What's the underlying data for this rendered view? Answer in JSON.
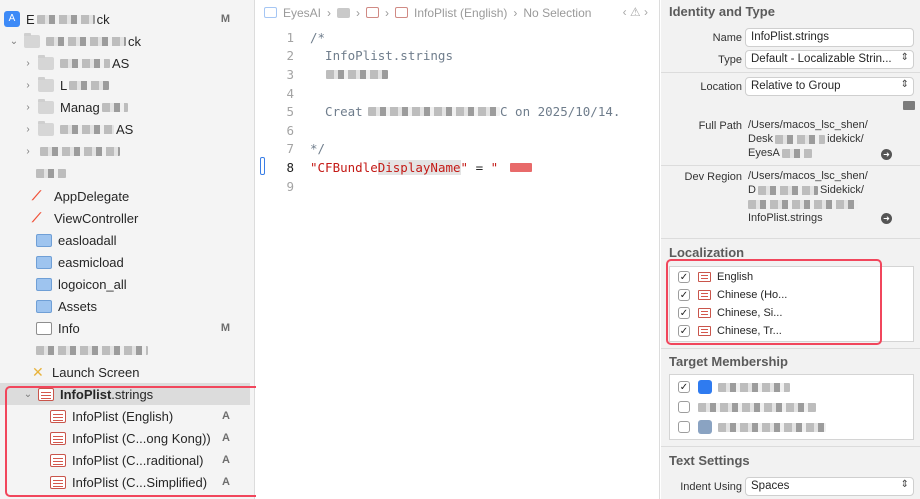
{
  "navigator": {
    "project_name": "E",
    "project_suffix": "ck",
    "project_badge": "M",
    "group_name_suffix": "ck",
    "folders": [
      {
        "label": "AS"
      },
      {
        "label": "L"
      },
      {
        "label": "Manag"
      },
      {
        "label": "AS"
      },
      {
        "label": ""
      }
    ],
    "files": [
      {
        "label": "AppDelegate",
        "badge": ""
      },
      {
        "label": "ViewController",
        "badge": ""
      },
      {
        "label": "easloadall",
        "badge": ""
      },
      {
        "label": "easmicload",
        "badge": ""
      },
      {
        "label": "logoicon_all",
        "badge": ""
      },
      {
        "label": "Assets",
        "badge": ""
      },
      {
        "label": "Info",
        "badge": "M"
      },
      {
        "label": "",
        "badge": ""
      },
      {
        "label": "Launch Screen",
        "badge": ""
      }
    ],
    "strings_group": {
      "prefix": "InfoPlist",
      "suffix": ".strings"
    },
    "localized_files": [
      {
        "label": "InfoPlist (English)",
        "badge": "A"
      },
      {
        "label": "InfoPlist (C...ong Kong))",
        "badge": "A"
      },
      {
        "label": "InfoPlist (C...raditional)",
        "badge": "A"
      },
      {
        "label": "InfoPlist (C...Simplified)",
        "badge": "A"
      }
    ]
  },
  "editor": {
    "jumpbar": {
      "project": "EyesAI",
      "file": "InfoPlist (English)",
      "selection": "No Selection",
      "nav": "‹ ⚠ ›"
    },
    "lines": [
      {
        "n": "1",
        "text": "/*"
      },
      {
        "n": "2",
        "text": "  InfoPlist.strings"
      },
      {
        "n": "3",
        "text": ""
      },
      {
        "n": "4",
        "text": ""
      },
      {
        "n": "5",
        "text_prefix": "  Creat",
        "text_suffix": "C on 2025/10/14."
      },
      {
        "n": "6",
        "text": ""
      },
      {
        "n": "7",
        "text": "*/"
      },
      {
        "n": "8",
        "key_open": "\"CFBundle",
        "key_hl": "DisplayName",
        "key_close": "\"",
        "eq": " = ",
        "val_open": "\""
      },
      {
        "n": "9",
        "text": ""
      }
    ]
  },
  "inspector": {
    "identity_title": "Identity and Type",
    "name_label": "Name",
    "name_value": "InfoPlist.strings",
    "type_label": "Type",
    "type_value": "Default - Localizable Strin...",
    "location_label": "Location",
    "location_value": "Relative to Group",
    "fullpath_label": "Full Path",
    "fullpath_lines": [
      "/Users/macos_lsc_shen/",
      "Desk",
      "EyesA"
    ],
    "fullpath_line2_suffix": "idekick/",
    "devregion_label": "Dev Region",
    "devregion_lines": [
      "/Users/macos_lsc_shen/",
      "D",
      "InfoPlist.strings"
    ],
    "devregion_line2_suffix": "Sidekick/",
    "localization_title": "Localization",
    "localizations": [
      {
        "label": "English",
        "checked": "✓"
      },
      {
        "label": "Chinese (Ho...",
        "checked": "✓"
      },
      {
        "label": "Chinese, Si...",
        "checked": "✓"
      },
      {
        "label": "Chinese, Tr...",
        "checked": "✓"
      }
    ],
    "target_title": "Target Membership",
    "targets": [
      {
        "checked": "✓"
      },
      {
        "checked": ""
      },
      {
        "checked": ""
      }
    ],
    "text_settings_title": "Text Settings",
    "indent_label": "Indent Using",
    "indent_value": "Spaces"
  }
}
